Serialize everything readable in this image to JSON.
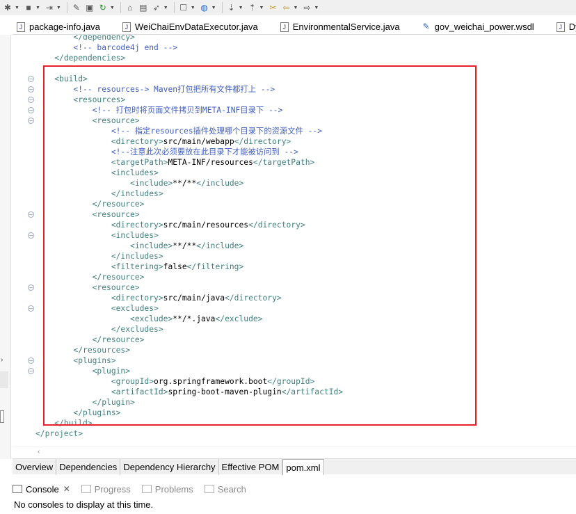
{
  "toolbar": {
    "icons": [
      "debug-icon",
      "stop-icon",
      "external-tools-icon",
      "new-project-icon",
      "package-icon",
      "refresh-icon",
      "open-folder-icon",
      "open-file-icon",
      "run-icon",
      "open-type-icon",
      "globe-icon",
      "prev-edit-icon",
      "next-edit-icon",
      "back-icon",
      "forward-icon"
    ]
  },
  "editor_tabs": [
    {
      "label": "package-info.java",
      "icon": "java-file-icon"
    },
    {
      "label": "WeiChaiEnvDataExecutor.java",
      "icon": "java-file-icon"
    },
    {
      "label": "EnvironmentalService.java",
      "icon": "java-file-icon"
    },
    {
      "label": "gov_weichai_power.wsdl",
      "icon": "wsdl-file-icon"
    },
    {
      "label": "DyMo",
      "icon": "java-file-icon"
    }
  ],
  "code": {
    "lines": [
      {
        "text": "        </dependency>",
        "fold": false
      },
      {
        "text": "        <!-- barcode4j end -->",
        "fold": false
      },
      {
        "text": "    </dependencies>",
        "fold": false
      },
      {
        "text": "",
        "fold": false
      },
      {
        "text": "    <build>",
        "fold": true
      },
      {
        "text": "        <!-- resources-> Maven打包把所有文件都打上 -->",
        "fold": true
      },
      {
        "text": "        <resources>",
        "fold": true
      },
      {
        "text": "            <!-- 打包时将页面文件拷贝到META-INF目录下 -->",
        "fold": true
      },
      {
        "text": "            <resource>",
        "fold": true
      },
      {
        "text": "                <!-- 指定resources插件处理哪个目录下的资源文件 -->",
        "fold": false
      },
      {
        "text": "                <directory>src/main/webapp</directory>",
        "fold": false
      },
      {
        "text": "                <!--注意此次必须要放在此目录下才能被访问到 -->",
        "fold": false
      },
      {
        "text": "                <targetPath>META-INF/resources</targetPath>",
        "fold": false
      },
      {
        "text": "                <includes>",
        "fold": false
      },
      {
        "text": "                    <include>**/**</include>",
        "fold": false
      },
      {
        "text": "                </includes>",
        "fold": false
      },
      {
        "text": "            </resource>",
        "fold": false
      },
      {
        "text": "            <resource>",
        "fold": true
      },
      {
        "text": "                <directory>src/main/resources</directory>",
        "fold": false
      },
      {
        "text": "                <includes>",
        "fold": true
      },
      {
        "text": "                    <include>**/**</include>",
        "fold": false
      },
      {
        "text": "                </includes>",
        "fold": false
      },
      {
        "text": "                <filtering>false</filtering>",
        "fold": false
      },
      {
        "text": "            </resource>",
        "fold": false
      },
      {
        "text": "            <resource>",
        "fold": true
      },
      {
        "text": "                <directory>src/main/java</directory>",
        "fold": false
      },
      {
        "text": "                <excludes>",
        "fold": true
      },
      {
        "text": "                    <exclude>**/*.java</exclude>",
        "fold": false
      },
      {
        "text": "                </excludes>",
        "fold": false
      },
      {
        "text": "            </resource>",
        "fold": false
      },
      {
        "text": "        </resources>",
        "fold": false
      },
      {
        "text": "        <plugins>",
        "fold": true
      },
      {
        "text": "            <plugin>",
        "fold": true
      },
      {
        "text": "                <groupId>org.springframework.boot</groupId>",
        "fold": false
      },
      {
        "text": "                <artifactId>spring-boot-maven-plugin</artifactId>",
        "fold": false
      },
      {
        "text": "            </plugin>",
        "fold": false
      },
      {
        "text": "        </plugins>",
        "fold": false
      },
      {
        "text": "    </build>",
        "fold": false
      },
      {
        "text": "</project>",
        "fold": false
      }
    ],
    "highlight_color": "#e8202a"
  },
  "pom_tabs": [
    {
      "label": "Overview",
      "active": false
    },
    {
      "label": "Dependencies",
      "active": false
    },
    {
      "label": "Dependency Hierarchy",
      "active": false
    },
    {
      "label": "Effective POM",
      "active": false
    },
    {
      "label": "pom.xml",
      "active": true
    }
  ],
  "views": {
    "console_label": "Console",
    "close_glyph": "✕",
    "progress_label": "Progress",
    "problems_label": "Problems",
    "search_label": "Search",
    "console_message": "No consoles to display at this time."
  }
}
